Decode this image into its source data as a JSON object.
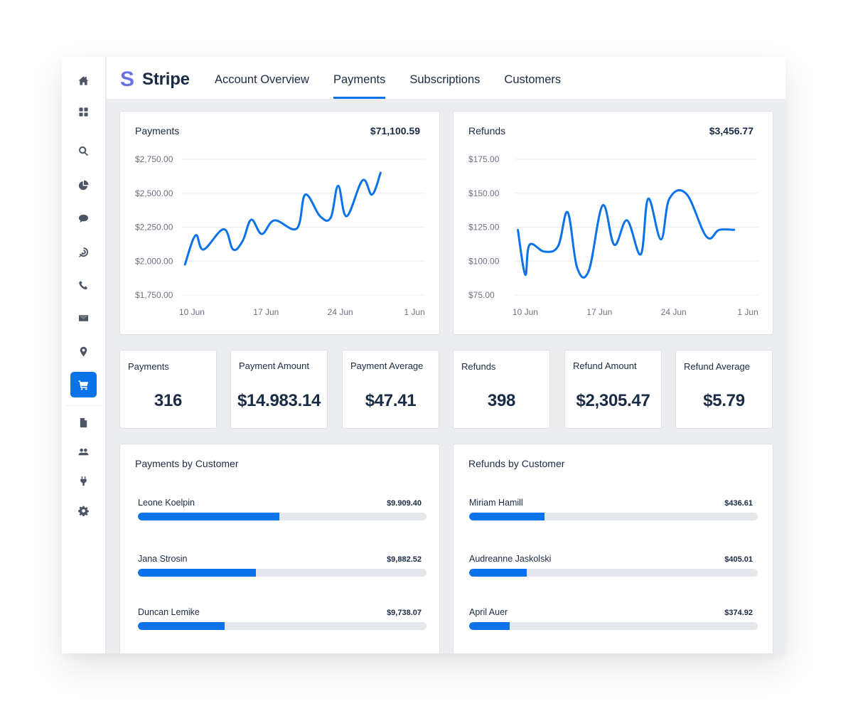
{
  "app": {
    "brand": "Stripe",
    "brand_mark": "S",
    "accent_color": "#0b73ea",
    "brand_color": "#6772e5"
  },
  "sidebar": {
    "items": [
      {
        "icon": "home-icon",
        "active": false
      },
      {
        "icon": "dashboard-grid-icon",
        "active": false
      },
      {
        "icon": "search-icon",
        "active": false
      },
      {
        "icon": "pie-chart-icon",
        "active": false
      },
      {
        "icon": "chat-bubble-icon",
        "active": false
      },
      {
        "icon": "target-icon",
        "active": false
      },
      {
        "icon": "phone-icon",
        "active": false
      },
      {
        "icon": "envelope-icon",
        "active": false
      },
      {
        "icon": "map-pin-icon",
        "active": false
      },
      {
        "icon": "shopping-cart-icon",
        "active": true
      },
      {
        "icon": "document-icon",
        "active": false
      },
      {
        "icon": "users-icon",
        "active": false
      },
      {
        "icon": "plug-icon",
        "active": false
      },
      {
        "icon": "gear-icon",
        "active": false
      }
    ]
  },
  "header": {
    "tabs": [
      {
        "label": "Account Overview",
        "active": false
      },
      {
        "label": "Payments",
        "active": true
      },
      {
        "label": "Subscriptions",
        "active": false
      },
      {
        "label": "Customers",
        "active": false
      }
    ]
  },
  "charts": {
    "payments": {
      "title": "Payments",
      "total": "$71,100.59"
    },
    "refunds": {
      "title": "Refunds",
      "total": "$3,456.77"
    }
  },
  "stats": [
    {
      "label": "Payments",
      "value": "316"
    },
    {
      "label": "Payment Amount",
      "value": "$14.983.14"
    },
    {
      "label": "Payment Average",
      "value": "$47.41"
    },
    {
      "label": "Refunds",
      "value": "398"
    },
    {
      "label": "Refund Amount",
      "value": "$2,305.47"
    },
    {
      "label": "Refund Average",
      "value": "$5.79"
    }
  ],
  "payments_by_customer": {
    "title": "Payments by Customer",
    "rows": [
      {
        "name": "Leone Koelpin",
        "value": "$9.909.40",
        "fill_percent": 49
      },
      {
        "name": "Jana Strosin",
        "value": "$9,882.52",
        "fill_percent": 41
      },
      {
        "name": "Duncan Lemike",
        "value": "$9,738.07",
        "fill_percent": 30
      }
    ]
  },
  "refunds_by_customer": {
    "title": "Refunds by Customer",
    "rows": [
      {
        "name": "Miriam Hamill",
        "value": "$436.61",
        "fill_percent": 26
      },
      {
        "name": "Audreanne Jaskolski",
        "value": "$405.01",
        "fill_percent": 20
      },
      {
        "name": "April Auer",
        "value": "$374.92",
        "fill_percent": 14
      }
    ]
  },
  "chart_data": [
    {
      "type": "line",
      "title": "Payments",
      "xlabel": "",
      "ylabel": "",
      "x_tick_labels": [
        "10 Jun",
        "17 Jun",
        "24 Jun",
        "1 Jun"
      ],
      "x_tick_positions": [
        1.5,
        8.5,
        15.5,
        22.5
      ],
      "y_ticks": [
        1750,
        2000,
        2250,
        2500,
        2750
      ],
      "y_tick_labels": [
        "$1,750.00",
        "$2,000.00",
        "$2,250.00",
        "$2,500.00",
        "$2,750.00"
      ],
      "ylim": [
        1750,
        2750
      ],
      "xlim": [
        0.5,
        23.5
      ],
      "grid": true,
      "series": [
        {
          "name": "Payments",
          "x": [
            0.85,
            1.85,
            2.6,
            4.5,
            5.4,
            6.3,
            7.1,
            8.1,
            9.3,
            11.4,
            12.2,
            13.6,
            14.6,
            15.3,
            16.1,
            17.6,
            18.5,
            19.3
          ],
          "values": [
            1975,
            2190,
            2085,
            2235,
            2085,
            2150,
            2305,
            2200,
            2300,
            2240,
            2490,
            2330,
            2320,
            2555,
            2330,
            2595,
            2490,
            2650
          ]
        }
      ]
    },
    {
      "type": "line",
      "title": "Refunds",
      "xlabel": "",
      "ylabel": "",
      "x_tick_labels": [
        "10 Jun",
        "17 Jun",
        "24 Jun",
        "1 Jun"
      ],
      "x_tick_positions": [
        1.5,
        8.5,
        15.5,
        22.5
      ],
      "y_ticks": [
        75,
        100,
        125,
        150,
        175
      ],
      "y_tick_labels": [
        "$75.00",
        "$100.00",
        "$125.00",
        "$150.00",
        "$175.00"
      ],
      "ylim": [
        75,
        175
      ],
      "xlim": [
        0.5,
        23.5
      ],
      "grid": true,
      "series": [
        {
          "name": "Refunds",
          "x": [
            0.8,
            1.5,
            1.9,
            3.3,
            4.6,
            5.5,
            6.4,
            7.5,
            8.8,
            9.9,
            11.1,
            12.4,
            13.1,
            14.3,
            15.1,
            16.7,
            18.6,
            19.8,
            21.2
          ],
          "values": [
            123,
            90,
            112,
            107,
            111,
            136,
            95,
            93,
            141,
            112,
            130,
            105,
            146,
            116,
            146,
            149.5,
            118,
            123,
            123
          ]
        }
      ]
    }
  ]
}
